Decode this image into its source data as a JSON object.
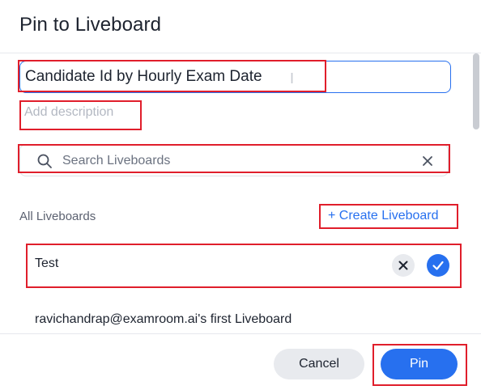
{
  "dialog": {
    "title": "Pin to Liveboard"
  },
  "form": {
    "name_value": "Candidate Id by Hourly Exam Date",
    "description_placeholder": "Add description",
    "search_placeholder": "Search Liveboards"
  },
  "liveboards": {
    "section_label": "All Liveboards",
    "create_label": "+ Create Liveboard",
    "items": [
      {
        "label": "Test",
        "selected": true
      },
      {
        "label": "ravichandrap@examroom.ai's first Liveboard",
        "selected": false
      }
    ]
  },
  "footer": {
    "cancel_label": "Cancel",
    "pin_label": "Pin"
  },
  "icons": {
    "search": "search-icon",
    "clear": "close-icon",
    "deselect": "close-icon",
    "selected": "check-icon"
  },
  "colors": {
    "accent": "#2770ef",
    "annotation": "#e01e2b",
    "secondary_button": "#e8eaee"
  }
}
